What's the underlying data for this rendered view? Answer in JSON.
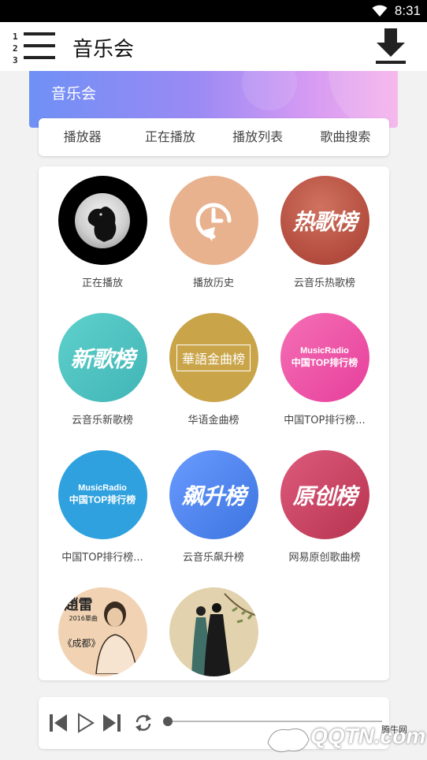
{
  "status_bar": {
    "time": "8:31"
  },
  "app_bar": {
    "title": "音乐会"
  },
  "banner": {
    "title": "音乐会"
  },
  "tabs": [
    {
      "label": "播放器"
    },
    {
      "label": "正在播放"
    },
    {
      "label": "播放列表"
    },
    {
      "label": "歌曲搜索"
    }
  ],
  "grid": [
    {
      "label": "正在播放",
      "icon": "crow-album-art",
      "art_text": ""
    },
    {
      "label": "播放历史",
      "icon": "history-clock-icon",
      "art_text": ""
    },
    {
      "label": "云音乐热歌榜",
      "icon": "hot-chart-logo",
      "art_text": "热歌榜"
    },
    {
      "label": "云音乐新歌榜",
      "icon": "new-chart-logo",
      "art_text": "新歌榜"
    },
    {
      "label": "华语金曲榜",
      "icon": "golden-chart-logo",
      "art_text": "華語金曲榜"
    },
    {
      "label": "中国TOP排行榜...",
      "icon": "music-radio-logo",
      "art_text": [
        "MusicRadio",
        "中国TOP排行榜"
      ]
    },
    {
      "label": "中国TOP排行榜...",
      "icon": "music-radio-logo",
      "art_text": [
        "MusicRadio",
        "中国TOP排行榜"
      ]
    },
    {
      "label": "云音乐飙升榜",
      "icon": "rising-chart-logo",
      "art_text": "飙升榜"
    },
    {
      "label": "网易原创歌曲榜",
      "icon": "original-chart-logo",
      "art_text": "原创榜"
    },
    {
      "label": "",
      "icon": "zhao-lei-album-art",
      "art_text": [
        "趙雷",
        "2016單曲",
        "《成都》"
      ]
    },
    {
      "label": "",
      "icon": "ink-painting-album-art",
      "art_text": ""
    }
  ],
  "player": {
    "progress": 0,
    "icons": [
      "skip-previous-icon",
      "play-icon",
      "skip-next-icon",
      "repeat-icon"
    ]
  },
  "watermark": {
    "text": "QQTN.com",
    "small": "腾牛网"
  },
  "colors": {
    "accent_gradient_start": "#6f90f5",
    "accent_gradient_end": "#f5b0ea",
    "status_bar": "#000000",
    "background": "#f2f2f2"
  }
}
